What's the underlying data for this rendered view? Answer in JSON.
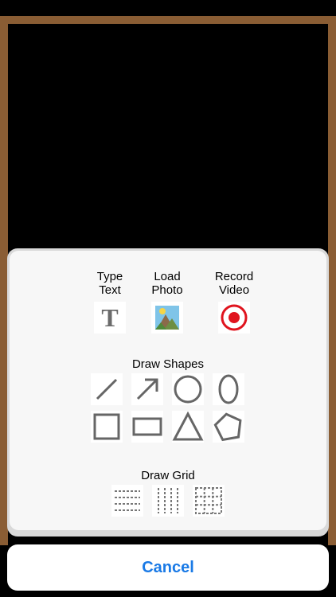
{
  "media": {
    "type_text": {
      "line1": "Type",
      "line2": "Text",
      "icon": "type-text-icon"
    },
    "load_photo": {
      "line1": "Load",
      "line2": "Photo",
      "icon": "photo-icon"
    },
    "record_video": {
      "line1": "Record",
      "line2": "Video",
      "icon": "record-icon"
    }
  },
  "shapes": {
    "title": "Draw Shapes",
    "items": [
      "line",
      "arrow",
      "circle",
      "ellipse",
      "square",
      "rectangle",
      "triangle",
      "pentagon"
    ]
  },
  "grid": {
    "title": "Draw Grid",
    "items": [
      "horizontal-lines",
      "vertical-lines",
      "grid"
    ]
  },
  "cancel_label": "Cancel",
  "colors": {
    "frame": "#8a5d34",
    "board": "#000000",
    "record_red": "#e0141e",
    "cancel_blue": "#1a7ae6",
    "shape_stroke": "#666666"
  }
}
